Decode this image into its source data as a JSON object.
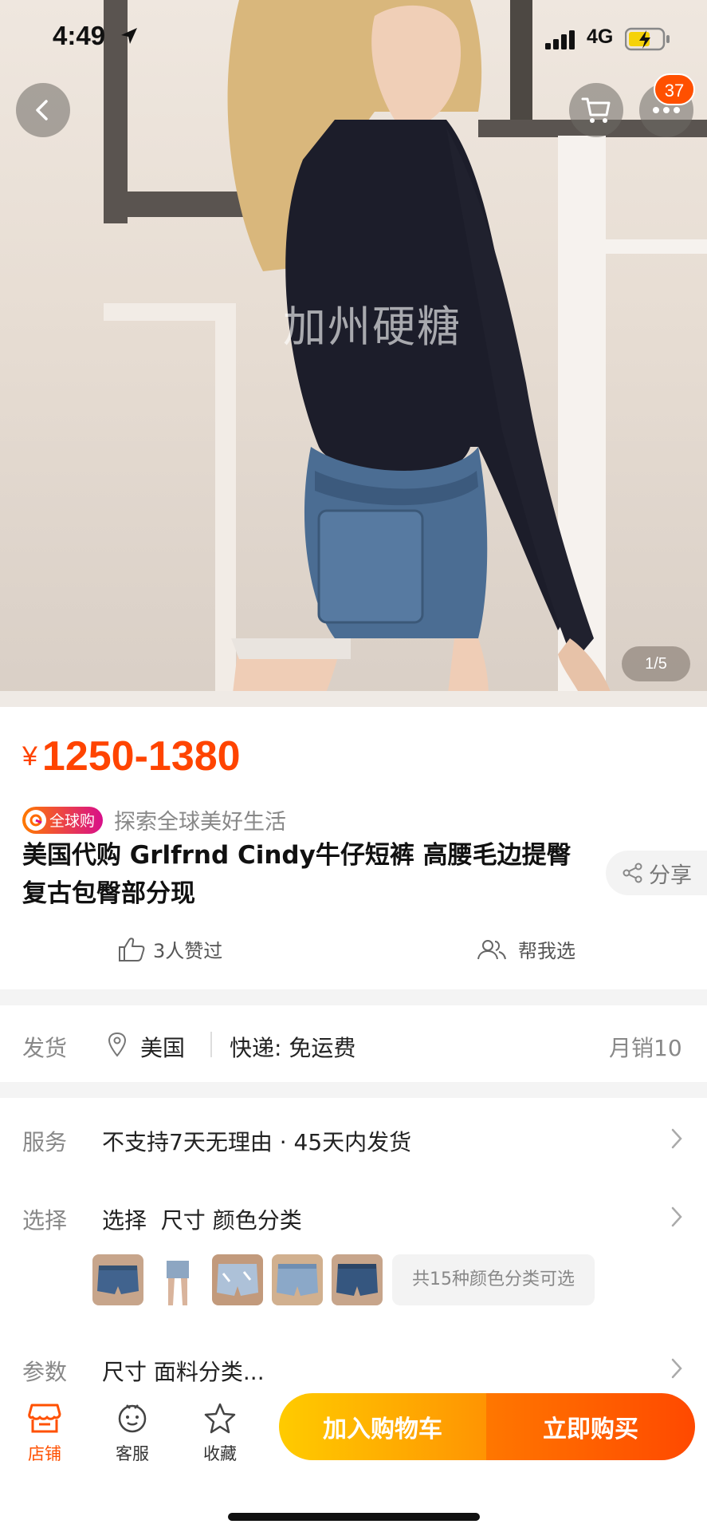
{
  "status_bar": {
    "time": "4:49",
    "network": "4G"
  },
  "header": {
    "cart_badge": "37"
  },
  "gallery": {
    "watermark": "加州硬糖",
    "page_indicator": "1/5"
  },
  "product": {
    "currency": "¥",
    "price": "1250-1380",
    "global_badge": "全球购",
    "slogan": "探索全球美好生活",
    "title": "美国代购 Grlfrnd Cindy牛仔短裤 高腰毛边提臀 复古包臀部分现",
    "share_label": "分享",
    "likes": "3人赞过",
    "help_choose": "帮我选"
  },
  "shipping": {
    "label": "发货",
    "location": "美国",
    "express": "快递: 免运费",
    "monthly_sales": "月销10"
  },
  "service": {
    "label": "服务",
    "value": "不支持7天无理由 · 45天内发货"
  },
  "selection": {
    "label": "选择",
    "value": "选择  尺寸 颜色分类",
    "colors_count": "共15种颜色分类可选"
  },
  "params": {
    "label": "参数",
    "value": "尺寸 面料分类..."
  },
  "bottom_bar": {
    "shop": "店铺",
    "customer_service": "客服",
    "favorite": "收藏",
    "add_to_cart": "加入购物车",
    "buy_now": "立即购买"
  },
  "colors": {
    "accent": "#ff5000",
    "price": "#ff4400",
    "cart_button": "#ffb000",
    "buy_button": "#ff5a00"
  }
}
